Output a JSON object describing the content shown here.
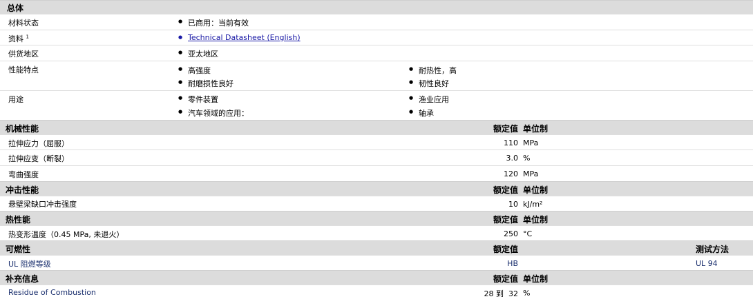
{
  "general": {
    "title": "总体",
    "rows": [
      {
        "label": "材料状态",
        "items": [
          "已商用：当前有效"
        ]
      },
      {
        "label": "资料",
        "sup": "1",
        "items": [
          "Technical Datasheet (English)"
        ]
      },
      {
        "label": "供货地区",
        "items": [
          "亚太地区"
        ]
      },
      {
        "label": "性能特点",
        "col1": [
          "高强度",
          "耐磨损性良好"
        ],
        "col2": [
          "耐热性，高",
          "韧性良好"
        ]
      },
      {
        "label": "用途",
        "col1": [
          "零件装置",
          "汽车领域的应用："
        ],
        "col2": [
          "渔业应用",
          "轴承"
        ]
      }
    ]
  },
  "sections": [
    {
      "title": "机械性能",
      "h_nominal": "额定值",
      "h_unit": "单位制",
      "h_method": "",
      "rows": [
        {
          "label": "拉伸应力（屈服）",
          "value": "110",
          "unit": "MPa",
          "method": ""
        },
        {
          "label": "拉伸应变（断裂）",
          "value": "3.0",
          "unit": "%",
          "method": ""
        },
        {
          "label": "弯曲强度",
          "value": "120",
          "unit": "MPa",
          "method": ""
        }
      ]
    },
    {
      "title": "冲击性能",
      "h_nominal": "额定值",
      "h_unit": "单位制",
      "h_method": "",
      "rows": [
        {
          "label": "悬壁梁缺口冲击强度",
          "value": "10",
          "unit": "kJ/m²",
          "method": ""
        }
      ]
    },
    {
      "title": "热性能",
      "h_nominal": "额定值",
      "h_unit": "单位制",
      "h_method": "",
      "rows": [
        {
          "label": "热变形温度（0.45 MPa, 未退火）",
          "value": "250",
          "unit": "°C",
          "method": ""
        }
      ]
    },
    {
      "title": "可燃性",
      "h_nominal": "额定值",
      "h_unit": "",
      "h_method": "测试方法",
      "rows": [
        {
          "label": "UL 阻燃等级",
          "value": "HB",
          "unit": "",
          "method": "UL 94"
        }
      ]
    },
    {
      "title": "补充信息",
      "h_nominal": "额定值",
      "h_unit": "单位制",
      "h_method": "",
      "rows": [
        {
          "label": "Residue of Combustion",
          "value": "28 到  32",
          "unit": "%",
          "method": ""
        }
      ]
    }
  ]
}
